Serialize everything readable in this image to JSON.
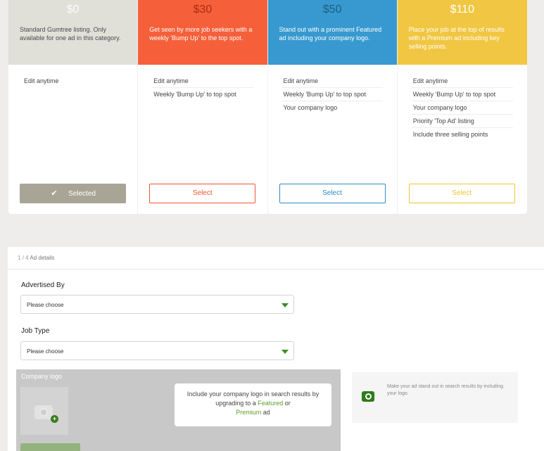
{
  "tiers": [
    {
      "price": "$0",
      "description": "Standard Gumtree listing. Only available for one ad in this category.",
      "features": [
        "Edit anytime"
      ],
      "button_label": "Selected",
      "button_icon": "check-icon",
      "selected": true
    },
    {
      "price": "$30",
      "description": "Get seen by more job seekers with a weekly 'Bump Up' to the top spot.",
      "features": [
        "Edit anytime",
        "Weekly 'Bump Up' to top spot"
      ],
      "button_label": "Select",
      "selected": false
    },
    {
      "price": "$50",
      "description": "Stand out with a prominent Featured ad including your company logo.",
      "features": [
        "Edit anytime",
        "Weekly 'Bump Up' to top spot",
        "Your company logo"
      ],
      "button_label": "Select",
      "selected": false
    },
    {
      "price": "$110",
      "description": "Place your job at the top of results with a Premium ad including key selling points.",
      "features": [
        "Edit anytime",
        "Weekly 'Bump Up' to top spot",
        "Your company logo",
        "Priority 'Top Ad' listing",
        "Include three selling points"
      ],
      "button_label": "Select",
      "selected": false
    }
  ],
  "colors": {
    "free": "#e0dfd8",
    "bump": "#f5603b",
    "featured": "#3799cf",
    "premium": "#f1c642",
    "accent_green": "#3f8b26"
  },
  "ad_details": {
    "step_number": "1 / 4",
    "step_title": "Ad details",
    "advertised_by": {
      "label": "Advertised By",
      "value": "Please choose"
    },
    "job_type": {
      "label": "Job Type",
      "value": "Please choose"
    },
    "company_logo": {
      "label": "Company logo",
      "upgrade_text_before": "Include your company logo in search results by upgrading to a",
      "featured_link": "Featured",
      "or_text": "or",
      "premium_link": "Premium",
      "upgrade_text_after": "ad"
    },
    "tip": {
      "icon": "camera-icon",
      "text": "Make your ad stand out in search results by including your logo."
    }
  }
}
